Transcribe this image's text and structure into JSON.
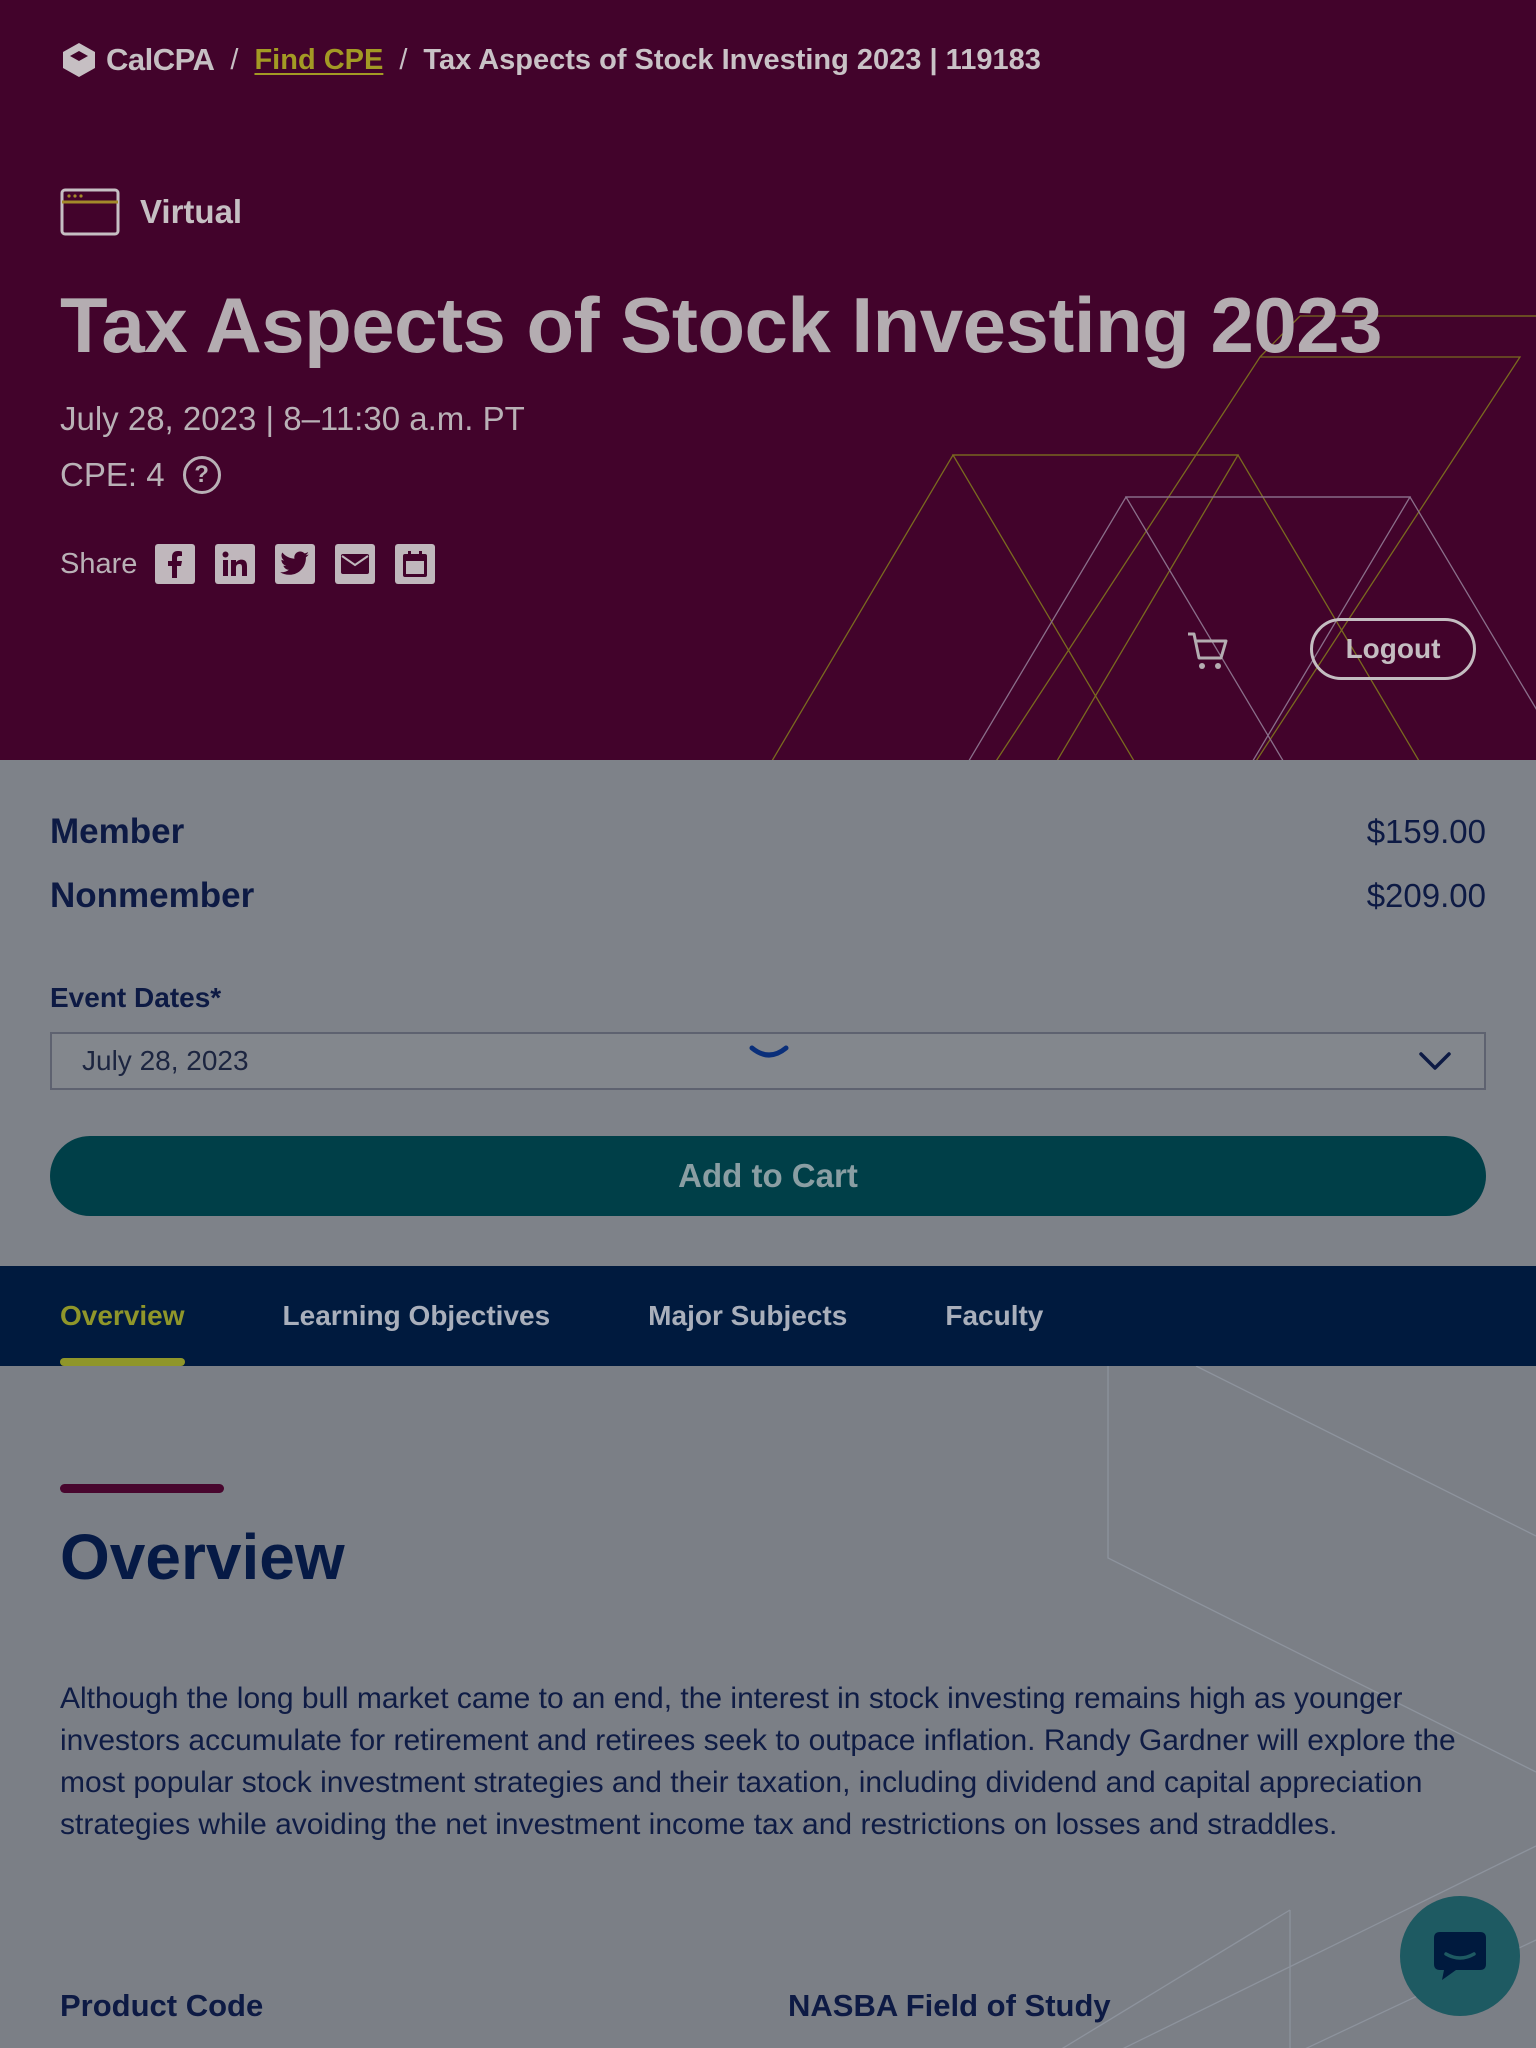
{
  "breadcrumb": {
    "logo_text": "CalCPA",
    "separator": "/",
    "link": "Find CPE",
    "current": "Tax Aspects of Stock Investing 2023 | 119183"
  },
  "event": {
    "format": "Virtual",
    "title": "Tax Aspects of Stock Investing 2023",
    "datetime": "July 28, 2023 | 8–11:30 a.m. PT",
    "cpe": "CPE: 4"
  },
  "share": {
    "label": "Share",
    "icons": [
      "facebook-icon",
      "linkedin-icon",
      "twitter-icon",
      "email-icon",
      "calendar-icon"
    ]
  },
  "header_actions": {
    "logout": "Logout"
  },
  "pricing": {
    "member_label": "Member",
    "member_price": "$159.00",
    "nonmember_label": "Nonmember",
    "nonmember_price": "$209.00"
  },
  "event_dates": {
    "label": "Event Dates*",
    "selected": "July 28, 2023"
  },
  "add_to_cart": "Add to Cart",
  "tabs": [
    {
      "label": "Overview",
      "active": true
    },
    {
      "label": "Learning Objectives",
      "active": false
    },
    {
      "label": "Major Subjects",
      "active": false
    },
    {
      "label": "Faculty",
      "active": false
    }
  ],
  "overview": {
    "heading": "Overview",
    "text": "Although the long bull market came to an end, the interest in stock investing remains high as younger investors accumulate for retirement and retirees seek to outpace inflation. Randy Gardner will explore the most popular stock investment strategies and their taxation, including dividend and capital appreciation strategies while avoiding the net investment income tax and restrictions on losses and straddles.",
    "product_code_label": "Product Code",
    "nasba_label": "NASBA Field of Study"
  },
  "colors": {
    "hero_bg": "#42032b",
    "panel_bg": "#7e8289",
    "tabs_bg": "#001a3e",
    "accent_olive": "#8f962a",
    "button_teal": "#003f48",
    "heading_navy": "#061a45"
  }
}
